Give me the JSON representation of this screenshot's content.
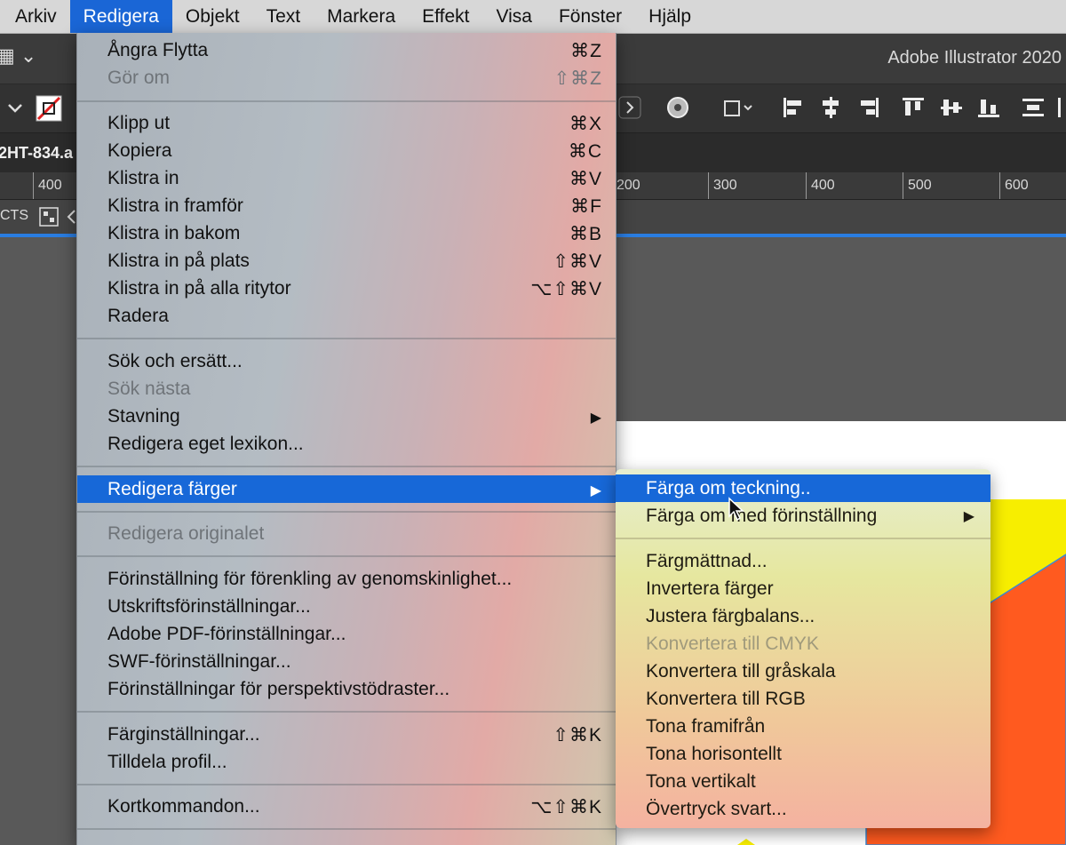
{
  "menubar": {
    "items": [
      "Arkiv",
      "Redigera",
      "Objekt",
      "Text",
      "Markera",
      "Effekt",
      "Visa",
      "Fönster",
      "Hjälp"
    ],
    "active_index": 1
  },
  "app": {
    "title": "Adobe Illustrator 2020",
    "doc_tab": "2HT-834.a",
    "ruler_ticks": [
      "400",
      "200",
      "300",
      "400",
      "500",
      "600"
    ],
    "panel_label": "CTS"
  },
  "edit_menu": {
    "items": [
      {
        "label": "Ångra Flytta",
        "shortcut": "⌘Z"
      },
      {
        "label": "Gör om",
        "shortcut": "⇧⌘Z",
        "disabled": true
      },
      {
        "label": "Klipp ut",
        "shortcut": "⌘X"
      },
      {
        "label": "Kopiera",
        "shortcut": "⌘C"
      },
      {
        "label": "Klistra in",
        "shortcut": "⌘V"
      },
      {
        "label": "Klistra in framför",
        "shortcut": "⌘F"
      },
      {
        "label": "Klistra in bakom",
        "shortcut": "⌘B"
      },
      {
        "label": "Klistra in på plats",
        "shortcut": "⇧⌘V"
      },
      {
        "label": "Klistra in på alla ritytor",
        "shortcut": "⌥⇧⌘V"
      },
      {
        "label": "Radera",
        "shortcut": ""
      },
      {
        "label": "Sök och ersätt...",
        "shortcut": ""
      },
      {
        "label": "Sök nästa",
        "shortcut": "",
        "disabled": true
      },
      {
        "label": "Stavning",
        "shortcut": "▶"
      },
      {
        "label": "Redigera eget lexikon...",
        "shortcut": ""
      },
      {
        "label": "Redigera färger",
        "shortcut": "▶",
        "selected": true
      },
      {
        "label": "Redigera originalet",
        "shortcut": "",
        "disabled": true
      },
      {
        "label": "Förinställning för förenkling av genomskinlighet...",
        "shortcut": ""
      },
      {
        "label": "Utskriftsförinställningar...",
        "shortcut": ""
      },
      {
        "label": "Adobe PDF-förinställningar...",
        "shortcut": ""
      },
      {
        "label": "SWF-förinställningar...",
        "shortcut": ""
      },
      {
        "label": "Förinställningar för perspektivstödraster...",
        "shortcut": ""
      },
      {
        "label": "Färginställningar...",
        "shortcut": "⇧⌘K"
      },
      {
        "label": "Tilldela profil...",
        "shortcut": ""
      },
      {
        "label": "Kortkommandon...",
        "shortcut": "⌥⇧⌘K"
      }
    ]
  },
  "color_submenu": {
    "items": [
      {
        "label": "Färga om teckning..",
        "selected": true
      },
      {
        "label": "Färga om med förinställning",
        "arrow": "▶"
      },
      {
        "label": "Färgmättnad..."
      },
      {
        "label": "Invertera färger"
      },
      {
        "label": "Justera färgbalans..."
      },
      {
        "label": "Konvertera till CMYK",
        "disabled": true
      },
      {
        "label": "Konvertera till gråskala"
      },
      {
        "label": "Konvertera till RGB"
      },
      {
        "label": "Tona framifrån"
      },
      {
        "label": "Tona horisontellt"
      },
      {
        "label": "Tona vertikalt"
      },
      {
        "label": "Övertryck svart..."
      }
    ]
  },
  "colors": {
    "menu_highlight": "#1768d8",
    "canvas_yellow": "#f7ee00",
    "canvas_orange": "#ff5a1f",
    "selection_blue": "#2a7de1"
  }
}
